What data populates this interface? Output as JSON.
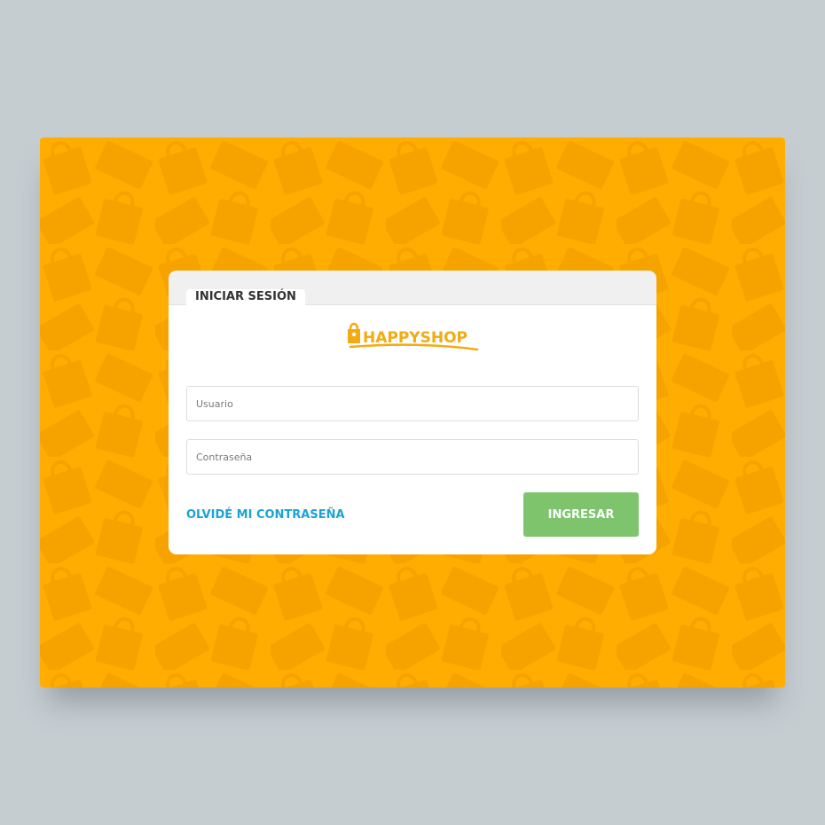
{
  "colors": {
    "page_background": "#c5cdd1",
    "pattern_background": "#ffad00",
    "pattern_shapes": "#f5a200",
    "brand": "#f2ab12",
    "link": "#1aa3d4",
    "submit_button": "#7dc46c"
  },
  "login": {
    "tab_label": "INICIAR SESIÓN",
    "logo": {
      "text": "HAPPYSHOP",
      "icon": "shopping-bag-icon"
    },
    "username_placeholder": "Usuario",
    "username_value": "",
    "password_placeholder": "Contraseña",
    "password_value": "",
    "forgot_password_label": "OLVIDÉ MI CONTRASEÑA",
    "submit_label": "INGRESAR"
  }
}
